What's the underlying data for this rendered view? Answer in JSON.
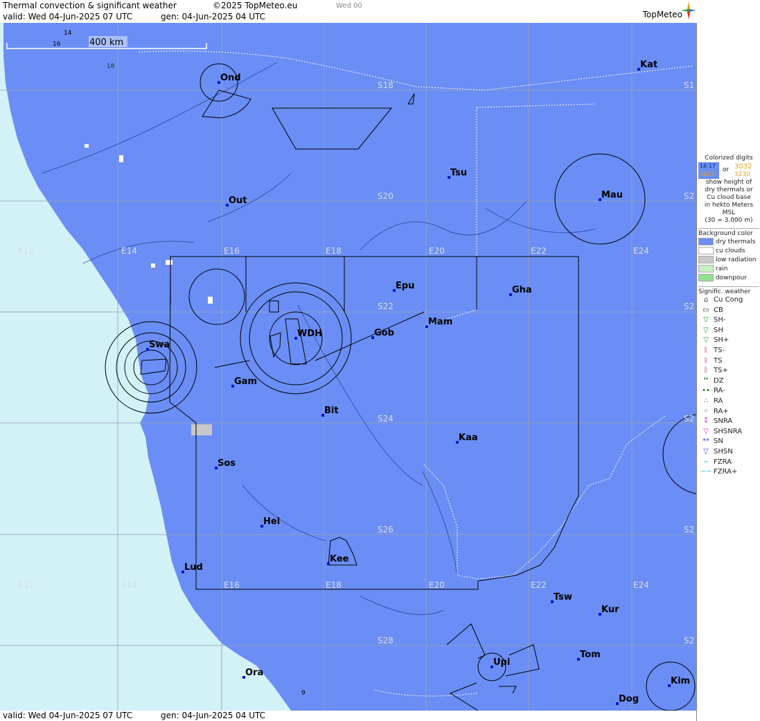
{
  "header": {
    "title": "Thermal convection & significant weather",
    "copyright": "©2025 TopMeteo.eu",
    "run": "Wed 00",
    "valid": "valid:  Wed  04-Jun-2025  07 UTC",
    "gen": "gen: 04-Jun-2025 04 UTC",
    "brand": "TopMeteo"
  },
  "footer": {
    "valid": "valid:  Wed  04-Jun-2025  07 UTC",
    "gen": "gen: 04-Jun-2025 04 UTC"
  },
  "scale": {
    "label": "400 km",
    "n14": "14",
    "n16": "16",
    "n18": "18"
  },
  "colors": {
    "sea": "#d2f2f8",
    "land": "#6a8ef5",
    "grid": "#9aa0b8",
    "line": "#000000"
  },
  "cities": [
    {
      "name": "Ond"
    },
    {
      "name": "Kat"
    },
    {
      "name": "Tsu"
    },
    {
      "name": "Mau"
    },
    {
      "name": "Out"
    },
    {
      "name": "Epu"
    },
    {
      "name": "Gha"
    },
    {
      "name": "Mam"
    },
    {
      "name": "Gob"
    },
    {
      "name": "WDH"
    },
    {
      "name": "Swa"
    },
    {
      "name": "Gam"
    },
    {
      "name": "Bit"
    },
    {
      "name": "Kaa"
    },
    {
      "name": "Sos"
    },
    {
      "name": "Hel"
    },
    {
      "name": "Kee"
    },
    {
      "name": "Lud"
    },
    {
      "name": "Tsw"
    },
    {
      "name": "Kur"
    },
    {
      "name": "Tom"
    },
    {
      "name": "Upi"
    },
    {
      "name": "Ora"
    },
    {
      "name": "Kim"
    },
    {
      "name": "Dog"
    }
  ],
  "grid_labels": {
    "lon": [
      "E12",
      "E14",
      "E16",
      "E18",
      "E20",
      "E22",
      "E24"
    ],
    "lat": [
      "S18",
      "S20",
      "S22",
      "S24",
      "S26",
      "S28"
    ],
    "edge": "S2",
    "edge_first": "S1",
    "misc": "9"
  },
  "legend": {
    "digits_title": [
      "Colorized digits"
    ],
    "digits_sample1": "16 17",
    "digits_or": "or",
    "digits_sample2": "3032",
    "digits_sample3": "2825",
    "digits_sample4": "3230",
    "digits_desc": [
      "show height of",
      "dry thermals or",
      "Cu cloud base",
      "in hekto Meters",
      "MSL",
      "(30 = 3.000 m)"
    ],
    "bg_title": "Background color",
    "bg_items": [
      {
        "label": "dry thermals",
        "color": "#6a8ef5"
      },
      {
        "label": "cu clouds",
        "color": "#ffffff"
      },
      {
        "label": "low radiation",
        "color": "#c8c8c8"
      },
      {
        "label": "rain",
        "color": "#c8f0c0"
      },
      {
        "label": "downpour",
        "color": "#90e090"
      }
    ],
    "wx_title": "Signific. weather",
    "wx_items": [
      {
        "symbol": "⌂",
        "label": "Cu Cong",
        "color": "#333333"
      },
      {
        "symbol": "▭",
        "label": "CB",
        "color": "#333333"
      },
      {
        "symbol": "▽",
        "label": "SH-",
        "color": "#2a8a2a"
      },
      {
        "symbol": "▽",
        "label": "SH",
        "color": "#2a8a2a"
      },
      {
        "symbol": "▽",
        "label": "SH+",
        "color": "#2a8a2a"
      },
      {
        "symbol": "ᚱ",
        "label": "TS-",
        "color": "#b01818"
      },
      {
        "symbol": "ᚱ",
        "label": "TS",
        "color": "#b01818"
      },
      {
        "symbol": "ᚱ",
        "label": "TS+",
        "color": "#b01818"
      },
      {
        "symbol": "❜❜",
        "label": "DZ",
        "color": "#1a6a1a"
      },
      {
        "symbol": "••",
        "label": "RA-",
        "color": "#1a6a1a"
      },
      {
        "symbol": "∴",
        "label": "RA",
        "color": "#1a6a1a"
      },
      {
        "symbol": "⁘",
        "label": "RA+",
        "color": "#1a6a1a"
      },
      {
        "symbol": "⁑",
        "label": "SNRA",
        "color": "#c030c0"
      },
      {
        "symbol": "▽",
        "label": "SHSNRA",
        "color": "#c030c0"
      },
      {
        "symbol": "**",
        "label": "SN",
        "color": "#3040d0"
      },
      {
        "symbol": "▽",
        "label": "SHSN",
        "color": "#3040d0"
      },
      {
        "symbol": "∽",
        "label": "FZRA",
        "color": "#20b8d8"
      },
      {
        "symbol": "∽∽",
        "label": "FZRA+",
        "color": "#20b8d8"
      }
    ]
  }
}
